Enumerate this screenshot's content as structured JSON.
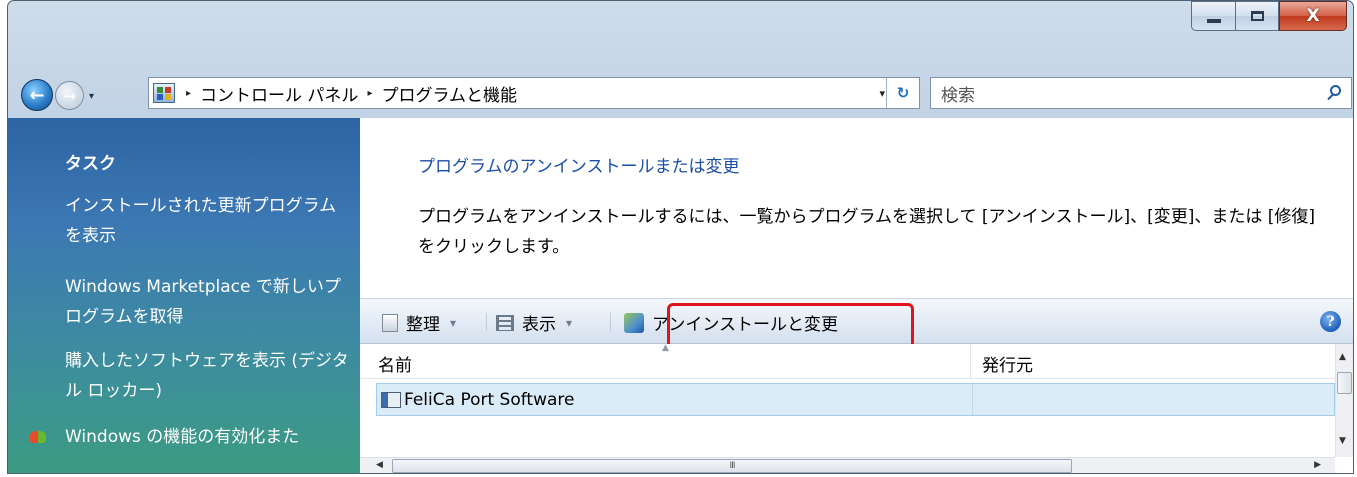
{
  "window": {
    "caption_buttons": {
      "minimize": "minimize-icon",
      "maximize": "maximize-icon",
      "close": "X"
    }
  },
  "address_bar": {
    "breadcrumbs": [
      "コントロール パネル",
      "プログラムと機能"
    ],
    "separator": "▸",
    "dropdown": "▾",
    "refresh": "↻"
  },
  "search": {
    "placeholder": "検索"
  },
  "sidebar": {
    "heading": "タスク",
    "items": [
      {
        "label": "インストールされた更新プログラムを表示"
      },
      {
        "label": "Windows Marketplace で新しいプログラムを取得"
      },
      {
        "label": "購入したソフトウェアを表示 (デジタル ロッカー)"
      },
      {
        "label": "Windows の機能の有効化また"
      }
    ]
  },
  "main": {
    "title": "プログラムのアンインストールまたは変更",
    "description": "プログラムをアンインストールするには、一覧からプログラムを選択して [アンインストール]、[変更]、または [修復] をクリックします。"
  },
  "toolbar": {
    "organize": "整理",
    "view": "表示",
    "uninstall_change": "アンインストールと変更",
    "dropdown": "▾",
    "help": "?"
  },
  "list": {
    "columns": [
      "名前",
      "発行元"
    ],
    "rows": [
      {
        "name": "FeliCa Port Software",
        "publisher": ""
      }
    ]
  },
  "scroll": {
    "h_thumb": "III"
  },
  "colors": {
    "highlight_border": "#e0141f",
    "link_blue": "#1a4ea8",
    "sidebar_top": "#2d64a4",
    "sidebar_bottom": "#3c9b82"
  }
}
